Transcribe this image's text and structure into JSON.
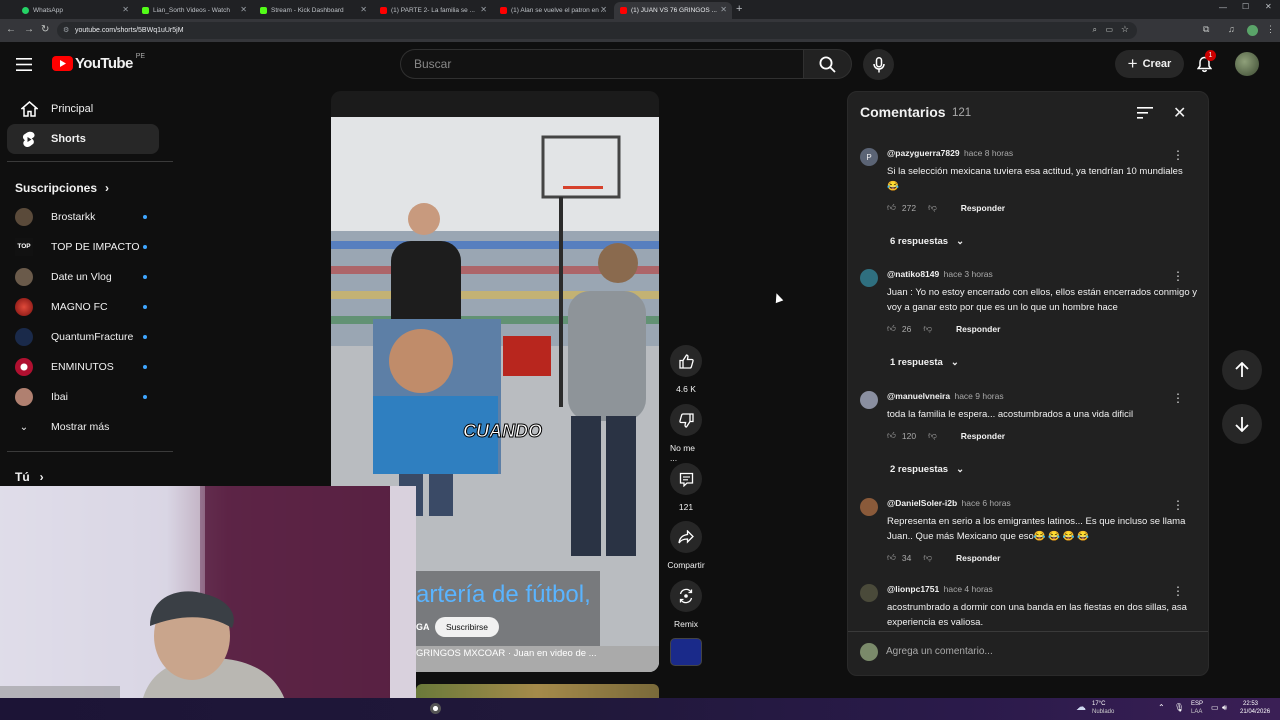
{
  "browser": {
    "tabs": [
      {
        "title": "WhatsApp",
        "color": "#25d366"
      },
      {
        "title": "Lian_Sorth Videos - Watch",
        "color": "#53fc18"
      },
      {
        "title": "Stream - Kick Dashboard",
        "color": "#53fc18"
      },
      {
        "title": "(1) PARTE 2- La familia se ...",
        "color": "#ff0000"
      },
      {
        "title": "(1) Alan se vuelve el patron en ...",
        "color": "#ff0000"
      },
      {
        "title": "(1) JUAN VS 76 GRINGOS ...",
        "color": "#ff0000"
      }
    ],
    "url": "youtube.com/shorts/5BWq1uUr5jM"
  },
  "header": {
    "logo": "YouTube",
    "country": "PE",
    "search_placeholder": "Buscar",
    "create_label": "Crear",
    "notif_count": "1"
  },
  "sidebar": {
    "main": [
      {
        "label": "Principal",
        "icon": "home-icon"
      },
      {
        "label": "Shorts",
        "icon": "shorts-icon"
      }
    ],
    "subs_title": "Suscripciones",
    "subs": [
      {
        "label": "Brostarkk",
        "color": "#5a4a3a"
      },
      {
        "label": "TOP DE IMPACTO",
        "color": "#111111"
      },
      {
        "label": "Date un Vlog",
        "color": "#6a5a4a"
      },
      {
        "label": "MAGNO FC",
        "color": "#c0392b"
      },
      {
        "label": "QuantumFracture",
        "color": "#1a2a4a"
      },
      {
        "label": "ENMINUTOS",
        "color": "#b01030"
      },
      {
        "label": "Ibai",
        "color": "#b08070"
      }
    ],
    "show_more": "Mostrar más",
    "you": "Tú"
  },
  "video": {
    "sign": "CUANDO",
    "caption": "artería de fútbol,",
    "channel_prefix": "GA",
    "subscribe": "Suscribirse",
    "title_line": "GRINGOS MXCOAR · Juan en video de ..."
  },
  "actions": {
    "likes": "4.6 K",
    "dislike": "No me ...",
    "comments": "121",
    "share": "Compartir",
    "remix": "Remix"
  },
  "comments": {
    "title": "Comentarios",
    "count": "121",
    "items": [
      {
        "user": "@pazyguerra7829",
        "time": "hace 8 horas",
        "text": "Si la selección mexicana tuviera esa actitud, ya tendrían 10 mundiales 😂",
        "likes": "272",
        "reply": "Responder",
        "replies": "6 respuestas",
        "avatar": "#5b6475",
        "initial": "P"
      },
      {
        "user": "@natiko8149",
        "time": "hace 3 horas",
        "text": "Juan : Yo no estoy encerrado con ellos, ellos están encerrados conmigo y voy a ganar esto por que es un lo que un hombre hace",
        "likes": "26",
        "reply": "Responder",
        "replies": "1 respuesta",
        "avatar": "#2f6f7f",
        "initial": ""
      },
      {
        "user": "@manuelvneira",
        "time": "hace 9 horas",
        "text": "toda la familia le espera... acostumbrados a una vida dificil",
        "likes": "120",
        "reply": "Responder",
        "replies": "2 respuestas",
        "avatar": "#8a8fa0",
        "initial": ""
      },
      {
        "user": "@DanielSoler-i2b",
        "time": "hace 6 horas",
        "text": "Representa en serio a los emigrantes latinos... Es que incluso se llama Juan.. Que más Mexicano que eso😂 😂 😂 😂",
        "likes": "34",
        "reply": "Responder",
        "replies": "",
        "avatar": "#8a5a3a",
        "initial": ""
      },
      {
        "user": "@lionpc1751",
        "time": "hace 4 horas",
        "text": "acostrumbrado a dormir con una banda en las fiestas en dos sillas, asa experiencia es valiosa.",
        "likes": "",
        "reply": "",
        "replies": "",
        "avatar": "#4a4a3a",
        "initial": ""
      }
    ],
    "add_placeholder": "Agrega un comentario..."
  },
  "taskbar": {
    "weather_temp": "17°C",
    "weather_desc": "Nublado",
    "lang1": "ESP",
    "lang2": "LAA",
    "time": "22:53",
    "date": "21/04/2026"
  }
}
